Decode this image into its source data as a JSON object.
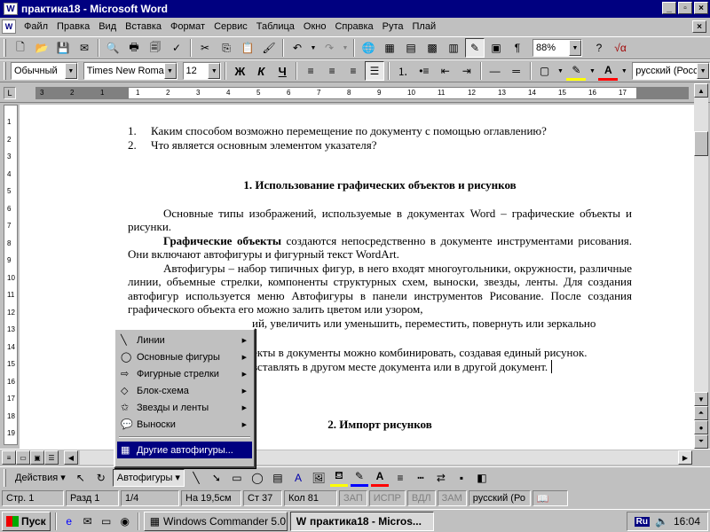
{
  "window": {
    "title": "практика18 - Microsoft Word",
    "app_icon": "W"
  },
  "menu": [
    "Файл",
    "Правка",
    "Вид",
    "Вставка",
    "Формат",
    "Сервис",
    "Таблица",
    "Окно",
    "Справка",
    "Рута",
    "Плай"
  ],
  "toolbar": {
    "zoom": "88%"
  },
  "format": {
    "style": "Обычный",
    "font": "Times New Roman",
    "size": "12",
    "bold": "Ж",
    "italic": "К",
    "underline": "Ч",
    "language": "русский (Росс"
  },
  "ruler": {
    "h_ticks": [
      "3",
      "2",
      "1",
      "1",
      "2",
      "3",
      "4",
      "5",
      "6",
      "7",
      "8",
      "9",
      "10",
      "11",
      "12",
      "13",
      "14",
      "15",
      "16",
      "17"
    ],
    "v_ticks": [
      "1",
      "2",
      "3",
      "4",
      "5",
      "6",
      "7",
      "8",
      "9",
      "10",
      "11",
      "12",
      "13",
      "14",
      "15",
      "16",
      "17",
      "18",
      "19"
    ]
  },
  "document": {
    "list": [
      {
        "num": "1.",
        "text": "Каким способом возможно перемещение по документу с помощью оглавлению?"
      },
      {
        "num": "2.",
        "text": "Что является основным элементом указателя?"
      }
    ],
    "heading1": "1. Использование графических объектов и рисунков",
    "p1": "Основные типы изображений, используемые в документах Word – графические объекты и рисунки.",
    "p2_bold": "Графические объекты",
    "p2_rest": " создаются непосредственно в документе инструментами рисования. Они включают автофигуры и фигурный текст WordArt.",
    "p3": "Автофигуры – набор типичных фигур, в него входят многоугольники, окружности, различные линии, объемные стрелки, компоненты структурных схем, выноски, звезды, ленты. Для создания автофигур используется меню Автофигуры в панели инструментов Рисование. После создания графического объекта его можно  залить цветом или узором, ",
    "p3_tail": "ий, увеличить или уменьшить, переместить, повернуть или зеркально",
    "p4a": "екты в документы можно комбинировать, создавая единый рисунок.",
    "p4b": "вставлять в другом месте документа или в другой документ.",
    "heading2": "2. Импорт рисунков"
  },
  "autoshapes_menu": [
    {
      "label": "Линии",
      "icon": "lines-icon",
      "submenu": true
    },
    {
      "label": "Основные фигуры",
      "icon": "basic-shapes-icon",
      "submenu": true
    },
    {
      "label": "Фигурные стрелки",
      "icon": "block-arrows-icon",
      "submenu": true
    },
    {
      "label": "Блок-схема",
      "icon": "flowchart-icon",
      "submenu": true
    },
    {
      "label": "Звезды и ленты",
      "icon": "stars-icon",
      "submenu": true
    },
    {
      "label": "Выноски",
      "icon": "callouts-icon",
      "submenu": true
    },
    {
      "label": "Другие автофигуры...",
      "icon": "more-shapes-icon",
      "submenu": false
    }
  ],
  "drawing": {
    "actions": "Действия",
    "autoshapes": "Автофигуры"
  },
  "status": {
    "page": "Стр. 1",
    "section": "Разд 1",
    "pages": "1/4",
    "at": "На 19,5см",
    "line": "Ст 37",
    "col": "Кол 81",
    "rec": "ЗАП",
    "trk": "ИСПР",
    "ext": "ВДЛ",
    "ovr": "ЗАМ",
    "lang": "русский (Ро"
  },
  "taskbar": {
    "start": "Пуск",
    "tasks": [
      "Windows Commander 5.0",
      "практика18 - Micros..."
    ],
    "lang": "Ru",
    "time": "16:04"
  }
}
